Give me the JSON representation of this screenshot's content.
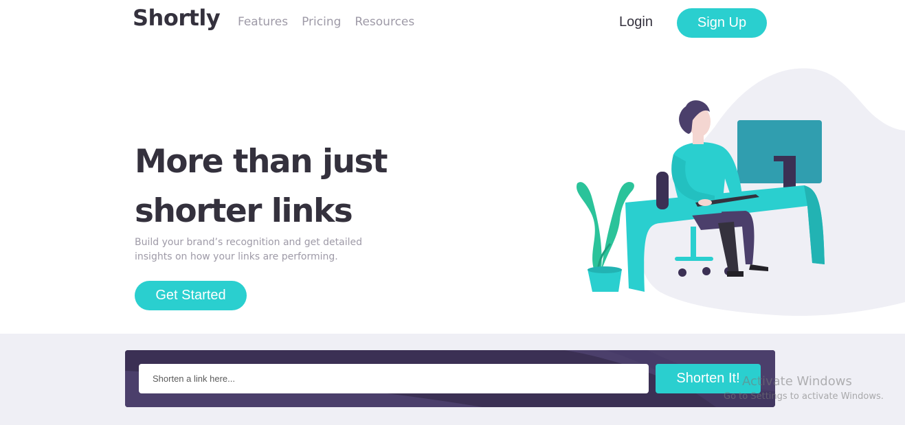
{
  "header": {
    "logo": "Shortly",
    "nav": [
      "Features",
      "Pricing",
      "Resources"
    ],
    "login": "Login",
    "signup": "Sign Up"
  },
  "hero": {
    "title": "More than just shorter links",
    "subtitle": "Build your brand’s recognition and get detailed insights on how your links are performing.",
    "cta": "Get Started"
  },
  "shorten": {
    "placeholder": "Shorten a link here...",
    "button": "Shorten It!"
  },
  "watermark": {
    "title": "Activate Windows",
    "subtitle": "Go to Settings to activate Windows."
  },
  "colors": {
    "primary": "#2acfcf",
    "dark_violet": "#3b3054",
    "grayish_violet": "#9e9aa7",
    "very_dark_violet": "#34313d"
  }
}
